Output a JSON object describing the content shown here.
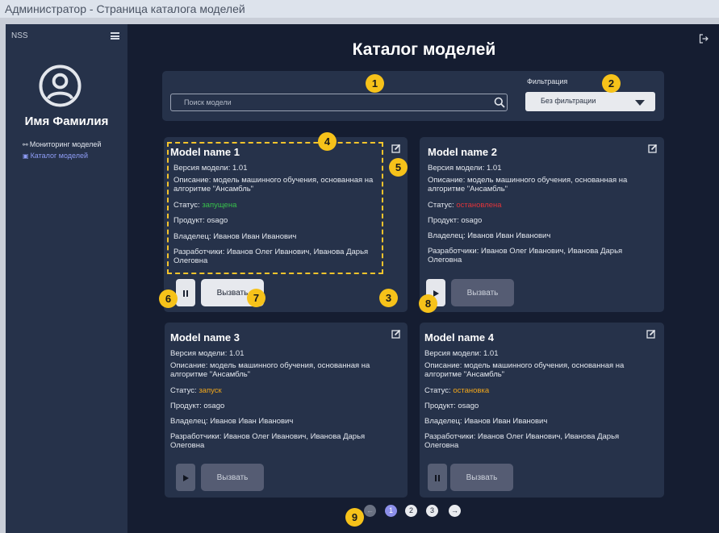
{
  "window": {
    "title": "Администратор -  Страница каталога моделей"
  },
  "sidebar": {
    "brand": "NSS",
    "user_name": "Имя Фамилия",
    "items": [
      {
        "icon": "monitoring-icon",
        "label": "Мониторинг моделей",
        "active": false
      },
      {
        "icon": "catalog-icon",
        "label": "Каталог моделей",
        "active": true
      }
    ]
  },
  "header": {
    "title": "Каталог моделей"
  },
  "search": {
    "placeholder": "Поиск модели",
    "value": ""
  },
  "filter": {
    "label": "Фильтрация",
    "selected": "Без фильтрации"
  },
  "cards": [
    {
      "name": "Model name 1",
      "version": "Версия модели: 1.01",
      "description": "Описание: модель машинного обучения, основанная на алгоритме \"Ансамбль\"",
      "status_label": "Статус: ",
      "status_value": "запущена",
      "product": "Продукт: osago",
      "owner": "Владелец: Иванов Иван Иванович",
      "developers": "Разработчики: Иванов Олег Иванович, Иванова Дарья Олеговна",
      "control_icon": "pause-icon",
      "call_label": "Вызвать"
    },
    {
      "name": "Model name 2",
      "version": "Версия модели: 1.01",
      "description": "Описание: модель машинного обучения, основанная на алгоритме \"Ансамбль\"",
      "status_label": "Статус: ",
      "status_value": "остановлена",
      "product": "Продукт: osago",
      "owner": "Владелец: Иванов Иван Иванович",
      "developers": "Разработчики: Иванов Олег Иванович, Иванова Дарья Олеговна",
      "control_icon": "play-icon",
      "call_label": "Вызвать"
    },
    {
      "name": "Model name 3",
      "version": "Версия модели: 1.01",
      "description": "Описание: модель машинного обучения, основанная на алгоритме \"Ансамбль\"",
      "status_label": "Статус: ",
      "status_value": "запуск",
      "product": "Продукт: osago",
      "owner": "Владелец: Иванов Иван Иванович",
      "developers": "Разработчики: Иванов Олег Иванович, Иванова Дарья Олеговна",
      "control_icon": "play-icon",
      "call_label": "Вызвать"
    },
    {
      "name": "Model name 4",
      "version": "Версия модели: 1.01",
      "description": "Описание: модель машинного обучения, основанная на алгоритме \"Ансамбль\"",
      "status_label": "Статус: ",
      "status_value": "остановка",
      "product": "Продукт: osago",
      "owner": "Владелец: Иванов Иван Иванович",
      "developers": "Разработчики: Иванов Олег Иванович, Иванова Дарья Олеговна",
      "control_icon": "pause-icon",
      "call_label": "Вызвать"
    }
  ],
  "pagination": {
    "prev": "←",
    "pages": [
      "1",
      "2",
      "3"
    ],
    "current": "1",
    "next": "→"
  },
  "annotations": [
    "1",
    "2",
    "3",
    "4",
    "5",
    "6",
    "7",
    "8",
    "9"
  ],
  "colors": {
    "background": "#151d31",
    "panel": "#26324a",
    "status_running": "#38c14b",
    "status_stopped": "#e0343a",
    "status_transition": "#f2a71b",
    "accent": "#8c8fe9",
    "annotation": "#f6c21a"
  }
}
